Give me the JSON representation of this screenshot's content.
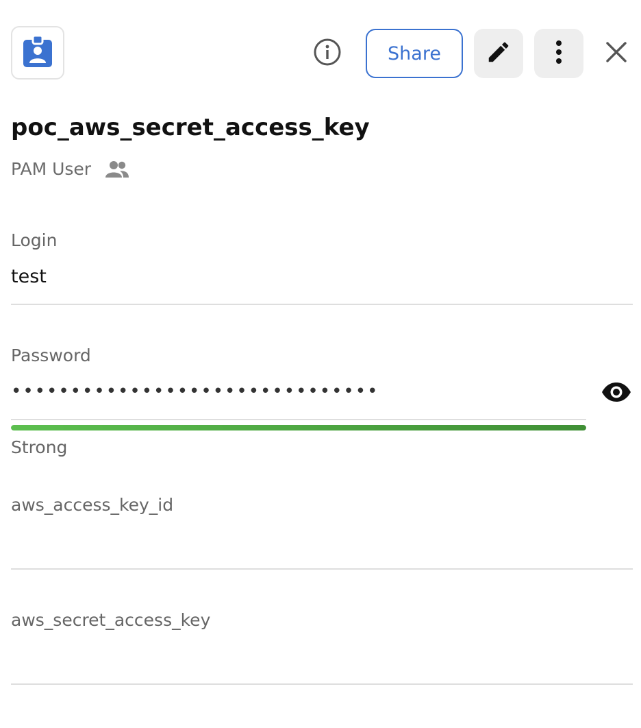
{
  "header": {
    "app_icon": "badge-person-icon",
    "info_icon": "info-icon",
    "share_label": "Share",
    "edit_icon": "pencil-icon",
    "more_icon": "more-vertical-icon",
    "close_icon": "close-icon",
    "accent_color": "#3b72d0"
  },
  "record": {
    "title": "poc_aws_secret_access_key",
    "type": "PAM User",
    "shared_icon": "people-icon"
  },
  "fields": {
    "login": {
      "label": "Login",
      "value": "test"
    },
    "password": {
      "label": "Password",
      "masked_value": "•••••••••••••••••••••••••••••••",
      "reveal_icon": "eye-icon",
      "strength_label": "Strong",
      "strength_fraction": 1.0,
      "strength_color": "#4caf50"
    },
    "aws_access_key_id": {
      "label": "aws_access_key_id",
      "value": ""
    },
    "aws_secret_access_key": {
      "label": "aws_secret_access_key",
      "value": ""
    }
  }
}
